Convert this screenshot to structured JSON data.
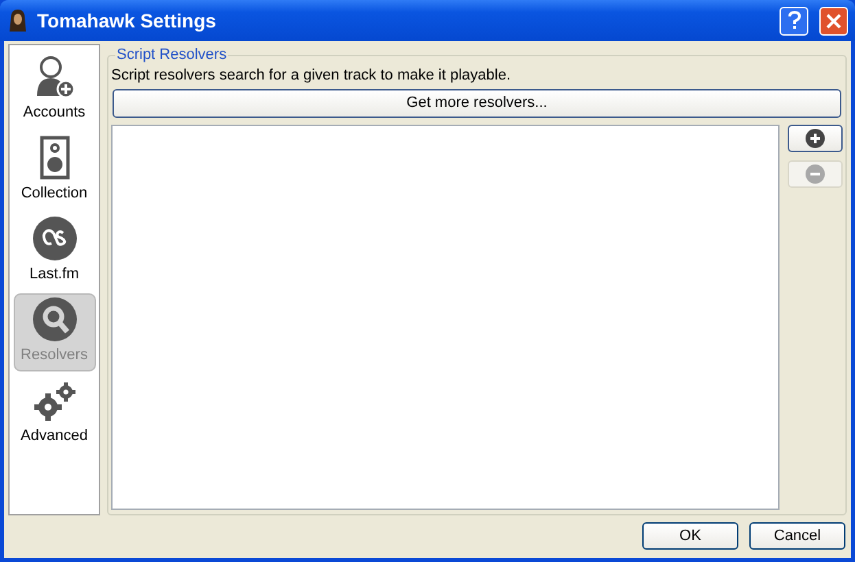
{
  "window": {
    "title": "Tomahawk Settings"
  },
  "sidebar": {
    "items": [
      {
        "label": "Accounts",
        "kind": "accounts",
        "selected": false
      },
      {
        "label": "Collection",
        "kind": "collection",
        "selected": false
      },
      {
        "label": "Last.fm",
        "kind": "lastfm",
        "selected": false
      },
      {
        "label": "Resolvers",
        "kind": "resolvers",
        "selected": true
      },
      {
        "label": "Advanced",
        "kind": "advanced",
        "selected": false
      }
    ]
  },
  "group": {
    "title": "Script Resolvers",
    "description": "Script resolvers search for a given track to make it playable.",
    "get_more_button": "Get more resolvers...",
    "add_disabled": false,
    "remove_disabled": true
  },
  "buttons": [
    "OK",
    "Cancel"
  ]
}
